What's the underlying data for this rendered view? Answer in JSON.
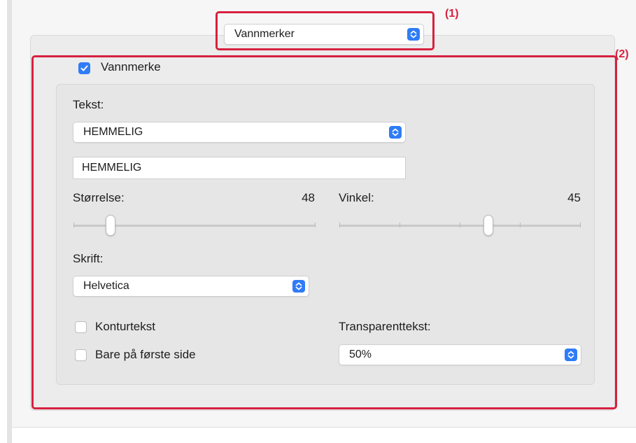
{
  "preset_menu": {
    "selected": "Vannmerker"
  },
  "watermark": {
    "enable_checkbox": {
      "label": "Vannmerke",
      "checked": true
    },
    "text_section": {
      "label": "Tekst:",
      "preset_selected": "HEMMELIG",
      "text_value": "HEMMELIG"
    },
    "size": {
      "label": "Størrelse:",
      "value": "48"
    },
    "angle": {
      "label": "Vinkel:",
      "value": "45"
    },
    "font": {
      "label": "Skrift:",
      "selected": "Helvetica"
    },
    "outline_checkbox": {
      "label": "Konturtekst",
      "checked": false
    },
    "first_page_checkbox": {
      "label": "Bare på første side",
      "checked": false
    },
    "transparency": {
      "label": "Transparenttekst:",
      "selected": "50%"
    }
  },
  "callouts": {
    "one": "(1)",
    "two": "(2)"
  },
  "colors": {
    "accent": "#2f7cf6",
    "callout": "#d6213f"
  },
  "icons": {
    "popup_stepper": "up-down-chevron-icon",
    "checkmark": "checkmark-icon"
  }
}
